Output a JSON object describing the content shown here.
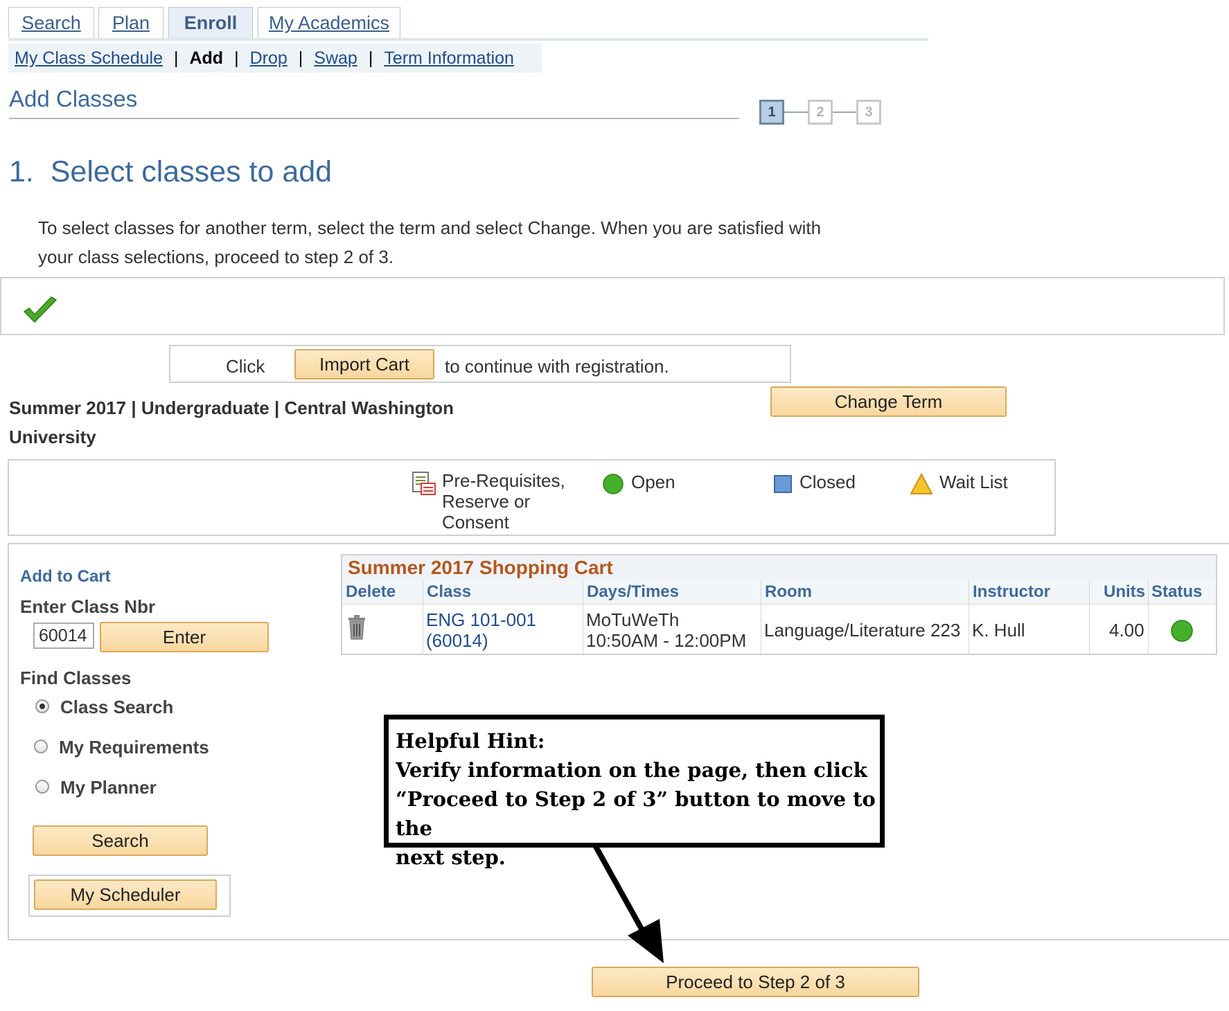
{
  "tabs": [
    {
      "label": "Search"
    },
    {
      "label": "Plan"
    },
    {
      "label": "Enroll"
    },
    {
      "label": "My Academics"
    }
  ],
  "subnav": {
    "my_class_schedule": "My Class Schedule",
    "add": "Add",
    "drop": "Drop",
    "swap": "Swap",
    "term_information": "Term Information",
    "separator": "|"
  },
  "page_title": "Add Classes",
  "steps": [
    "1",
    "2",
    "3"
  ],
  "step_heading": "1.  Select classes to add",
  "instructions": "To select classes for another term, select the term and select Change.  When you are satisfied with your class selections, proceed to step 2 of 3.",
  "import": {
    "prefix": "Click",
    "button": "Import Cart",
    "suffix": "to continue with registration."
  },
  "change_term_button": "Change Term",
  "term_info": "Summer 2017 | Undergraduate | Central Washington University",
  "legend": {
    "prereq": "Pre-Requisites, Reserve or Consent",
    "open": "Open",
    "closed": "Closed",
    "waitlist": "Wait List"
  },
  "add_to_cart": {
    "title": "Add to Cart",
    "enter_label": "Enter Class Nbr",
    "class_nbr_value": "60014",
    "enter_button": "Enter"
  },
  "find_classes": {
    "title": "Find Classes",
    "options": [
      {
        "label": "Class Search",
        "selected": true
      },
      {
        "label": "My Requirements",
        "selected": false
      },
      {
        "label": "My Planner",
        "selected": false
      }
    ],
    "search_button": "Search",
    "scheduler_button": "My Scheduler"
  },
  "cart": {
    "title": "Summer 2017 Shopping Cart",
    "columns": [
      "Delete",
      "Class",
      "Days/Times",
      "Room",
      "Instructor",
      "Units",
      "Status"
    ],
    "rows": [
      {
        "class_code": "ENG 101-001",
        "class_nbr": "(60014)",
        "days": "MoTuWeTh",
        "times": "10:50AM - 12:00PM",
        "room": "Language/Literature 223",
        "instructor": "K. Hull",
        "units": "4.00",
        "status": "open"
      }
    ]
  },
  "hint": {
    "title": "Helpful Hint:",
    "line1": "Verify information on the page, then click",
    "line2": "“Proceed to Step 2 of 3” button to move to the",
    "line3": "next step."
  },
  "proceed_button": "Proceed to Step 2 of 3",
  "colors": {
    "accent_blue": "#3d6a9a",
    "button_fill": "#f8d79d",
    "cart_title": "#b3591f",
    "open_green": "#45b02c",
    "closed_blue": "#6a9ad6",
    "waitlist_yellow": "#f6c52b"
  }
}
